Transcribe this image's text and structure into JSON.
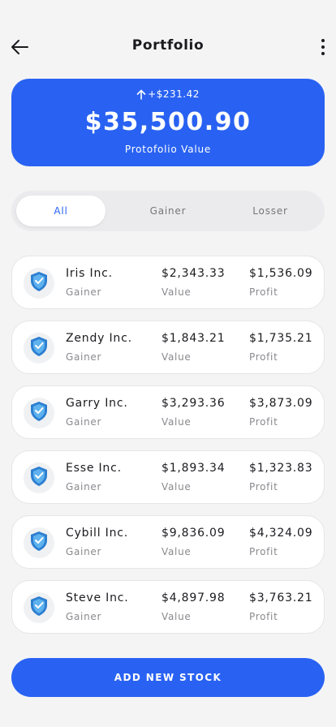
{
  "header": {
    "title": "Portfolio"
  },
  "summary": {
    "change": "+$231.42",
    "total": "$35,500.90",
    "label": "Protofolio Value"
  },
  "tabs": [
    {
      "label": "All"
    },
    {
      "label": "Gainer"
    },
    {
      "label": "Losser"
    }
  ],
  "stocks": [
    {
      "name": "Iris Inc.",
      "type": "Gainer",
      "value": "$2,343.33",
      "value_label": "Value",
      "profit": "$1,536.09",
      "profit_label": "Profit"
    },
    {
      "name": "Zendy Inc.",
      "type": "Gainer",
      "value": "$1,843.21",
      "value_label": "Value",
      "profit": "$1,735.21",
      "profit_label": "Profit"
    },
    {
      "name": "Garry Inc.",
      "type": "Gainer",
      "value": "$3,293.36",
      "value_label": "Value",
      "profit": "$3,873.09",
      "profit_label": "Profit"
    },
    {
      "name": "Esse Inc.",
      "type": "Gainer",
      "value": "$1,893.34",
      "value_label": "Value",
      "profit": "$1,323.83",
      "profit_label": "Profit"
    },
    {
      "name": "Cybill Inc.",
      "type": "Gainer",
      "value": "$9,836.09",
      "value_label": "Value",
      "profit": "$4,324.09",
      "profit_label": "Profit"
    },
    {
      "name": "Steve Inc.",
      "type": "Gainer",
      "value": "$4,897.98",
      "value_label": "Value",
      "profit": "$3,763.21",
      "profit_label": "Profit"
    }
  ],
  "actions": {
    "add_label": "ADD NEW STOCK"
  },
  "icons": {
    "back": "arrow-left-icon",
    "more": "more-vertical-icon",
    "change": "arrow-up-icon",
    "logo": "shield-logo-icon"
  },
  "colors": {
    "accent": "#2962f2",
    "background": "#f4f4f5"
  }
}
